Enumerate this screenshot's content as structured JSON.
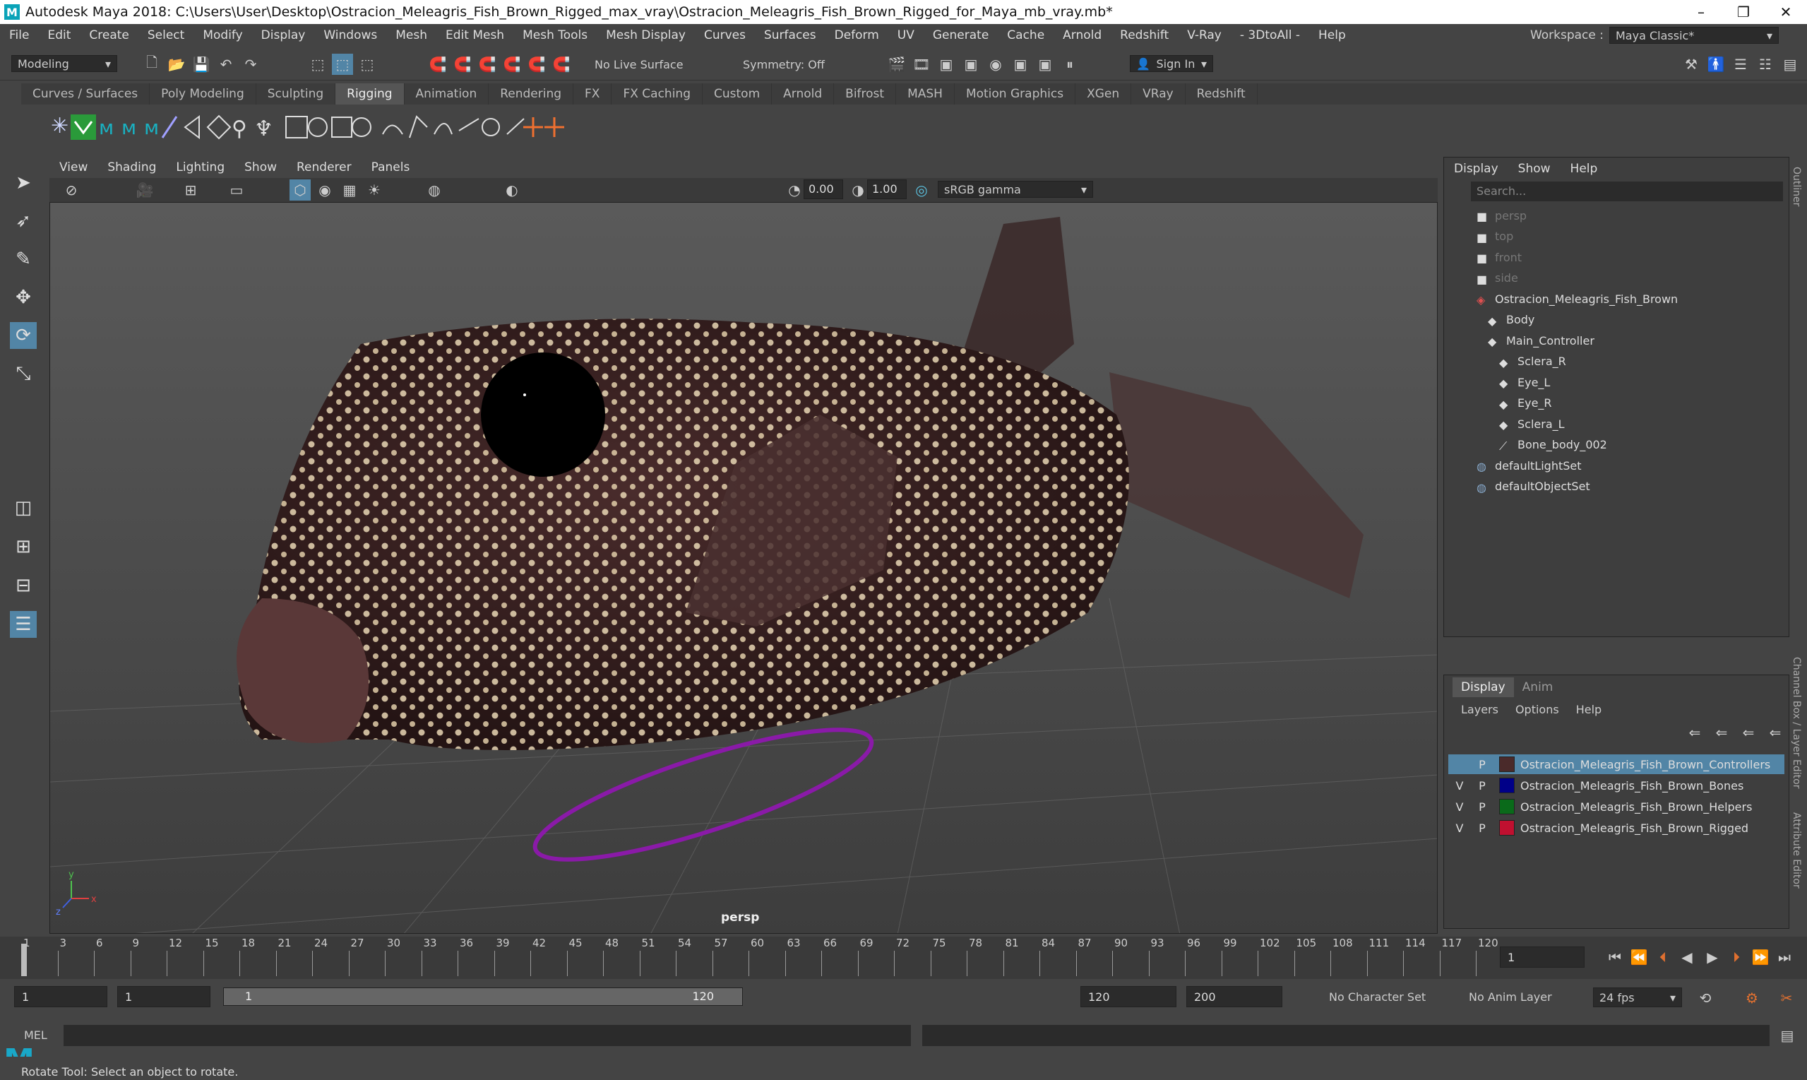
{
  "window": {
    "title": "Autodesk Maya 2018: C:\\Users\\User\\Desktop\\Ostracion_Meleagris_Fish_Brown_Rigged_max_vray\\Ostracion_Meleagris_Fish_Brown_Rigged_for_Maya_mb_vray.mb*",
    "logo": "M",
    "minimize": "–",
    "restore": "❐",
    "close": "✕"
  },
  "menubar": {
    "items": [
      "File",
      "Edit",
      "Create",
      "Select",
      "Modify",
      "Display",
      "Windows",
      "Mesh",
      "Edit Mesh",
      "Mesh Tools",
      "Mesh Display",
      "Curves",
      "Surfaces",
      "Deform",
      "UV",
      "Generate",
      "Cache",
      "Arnold",
      "Redshift",
      "V-Ray",
      "- 3DtoAll -",
      "Help"
    ],
    "workspace_label": "Workspace :",
    "workspace_value": "Maya Classic*"
  },
  "status": {
    "mode": "Modeling",
    "live_surface": "No Live Surface",
    "symmetry": "Symmetry: Off",
    "sign_in": "Sign In"
  },
  "shelf_tabs": [
    "Curves / Surfaces",
    "Poly Modeling",
    "Sculpting",
    "Rigging",
    "Animation",
    "Rendering",
    "FX",
    "FX Caching",
    "Custom",
    "Arnold",
    "Bifrost",
    "MASH",
    "Motion Graphics",
    "XGen",
    "VRay",
    "Redshift"
  ],
  "viewport": {
    "menu": [
      "View",
      "Shading",
      "Lighting",
      "Show",
      "Renderer",
      "Panels"
    ],
    "exposure": "0.00",
    "gamma": "1.00",
    "color_space": "sRGB gamma",
    "camera": "persp"
  },
  "outliner": {
    "menu": [
      "Display",
      "Show",
      "Help"
    ],
    "search_placeholder": "Search...",
    "items": [
      {
        "label": "persp",
        "indent": 1,
        "dim": true,
        "icon": "camera"
      },
      {
        "label": "top",
        "indent": 1,
        "dim": true,
        "icon": "camera"
      },
      {
        "label": "front",
        "indent": 1,
        "dim": true,
        "icon": "camera"
      },
      {
        "label": "side",
        "indent": 1,
        "dim": true,
        "icon": "camera"
      },
      {
        "label": "Ostracion_Meleagris_Fish_Brown",
        "indent": 1,
        "dim": false,
        "icon": "joint"
      },
      {
        "label": "Body",
        "indent": 2,
        "dim": false,
        "icon": "transform"
      },
      {
        "label": "Main_Controller",
        "indent": 2,
        "dim": false,
        "icon": "transform"
      },
      {
        "label": "Sclera_R",
        "indent": 3,
        "dim": false,
        "icon": "transform"
      },
      {
        "label": "Eye_L",
        "indent": 3,
        "dim": false,
        "icon": "transform"
      },
      {
        "label": "Eye_R",
        "indent": 3,
        "dim": false,
        "icon": "transform"
      },
      {
        "label": "Sclera_L",
        "indent": 3,
        "dim": false,
        "icon": "transform"
      },
      {
        "label": "Bone_body_002",
        "indent": 3,
        "dim": false,
        "icon": "bone"
      },
      {
        "label": "defaultLightSet",
        "indent": 1,
        "dim": false,
        "icon": "set"
      },
      {
        "label": "defaultObjectSet",
        "indent": 1,
        "dim": false,
        "icon": "set"
      }
    ]
  },
  "layer_editor": {
    "tabs": [
      "Display",
      "Anim"
    ],
    "menu": [
      "Layers",
      "Options",
      "Help"
    ],
    "layers": [
      {
        "v": "",
        "p": "P",
        "name": "Ostracion_Meleagris_Fish_Brown_Controllers",
        "color": "#4a2a2a",
        "selected": true
      },
      {
        "v": "V",
        "p": "P",
        "name": "Ostracion_Meleagris_Fish_Brown_Bones",
        "color": "#000088",
        "selected": false
      },
      {
        "v": "V",
        "p": "P",
        "name": "Ostracion_Meleagris_Fish_Brown_Helpers",
        "color": "#0a6a1a",
        "selected": false
      },
      {
        "v": "V",
        "p": "P",
        "name": "Ostracion_Meleagris_Fish_Brown_Rigged",
        "color": "#c01030",
        "selected": false
      }
    ]
  },
  "side_tabs": {
    "outliner": "Outliner",
    "channel_box": "Channel Box / Layer Editor",
    "attribute": "Attribute Editor"
  },
  "timeline": {
    "ticks": [
      "1",
      "3",
      "6",
      "9",
      "12",
      "15",
      "18",
      "21",
      "24",
      "27",
      "30",
      "33",
      "36",
      "39",
      "42",
      "45",
      "48",
      "51",
      "54",
      "57",
      "60",
      "63",
      "66",
      "69",
      "72",
      "75",
      "78",
      "81",
      "84",
      "87",
      "90",
      "93",
      "96",
      "99",
      "102",
      "105",
      "108",
      "111",
      "114",
      "117",
      "120"
    ],
    "current_frame": "1"
  },
  "range": {
    "start": "1",
    "playback_start": "1",
    "slider_start": "1",
    "slider_end": "120",
    "playback_end": "120",
    "end": "200",
    "character_set": "No Character Set",
    "anim_layer": "No Anim Layer",
    "fps": "24 fps"
  },
  "cmdline": {
    "label": "MEL"
  },
  "helpline": {
    "text": "Rotate Tool: Select an object to rotate."
  },
  "colors": {
    "accent": "#5285a6",
    "curve": "#8a1aa8",
    "fish": "#3a2222"
  }
}
